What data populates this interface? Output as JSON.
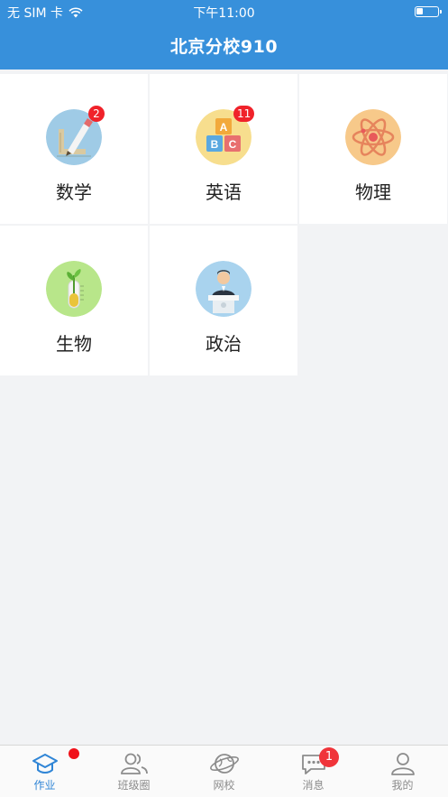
{
  "status_bar": {
    "carrier": "无 SIM 卡",
    "time": "下午11:00"
  },
  "header": {
    "title": "北京分校910"
  },
  "subjects": [
    {
      "label": "数学",
      "icon": "geometry-ruler-pencil-icon",
      "badge": "2"
    },
    {
      "label": "英语",
      "icon": "abc-blocks-icon",
      "badge": "11"
    },
    {
      "label": "物理",
      "icon": "atom-icon",
      "badge": ""
    },
    {
      "label": "生物",
      "icon": "test-tube-plant-icon",
      "badge": ""
    },
    {
      "label": "政治",
      "icon": "speaker-podium-icon",
      "badge": ""
    }
  ],
  "tabbar": {
    "items": [
      {
        "label": "作业",
        "icon": "graduation-cap-icon",
        "active": true
      },
      {
        "label": "班级圈",
        "icon": "people-icon",
        "active": false
      },
      {
        "label": "网校",
        "icon": "globe-icon",
        "active": false
      },
      {
        "label": "消息",
        "icon": "chat-bubble-icon",
        "active": false,
        "badge": "1"
      },
      {
        "label": "我的",
        "icon": "person-icon",
        "active": false
      }
    ]
  },
  "colors": {
    "header": "#3790db",
    "tab_active": "#2f85d6",
    "badge": "#f0222a",
    "background": "#f2f3f5"
  }
}
